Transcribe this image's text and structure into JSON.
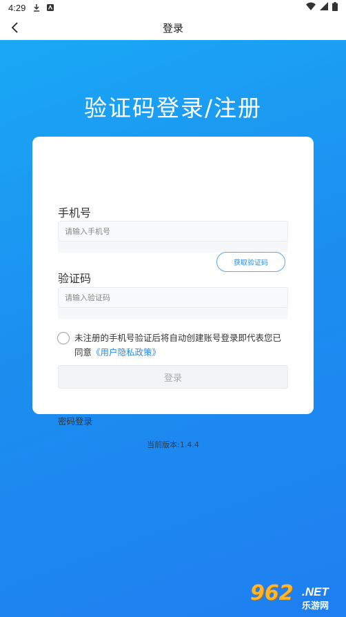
{
  "status_bar": {
    "time": "4:29",
    "icons_left": [
      "download-icon",
      "notification-icon"
    ],
    "icons_right": [
      "wifi-icon",
      "signal-icon",
      "battery-icon"
    ]
  },
  "header": {
    "title": "登录",
    "back_icon": "back-arrow-icon"
  },
  "hero": {
    "title": "验证码登录/注册"
  },
  "form": {
    "phone_label": "手机号",
    "phone_placeholder": "请输入手机号",
    "code_label": "验证码",
    "code_placeholder": "请输入验证码",
    "get_code_label": "获取验证码",
    "agreement_text": "未注册的手机号验证后将自动创建账号登录即代表您已同意",
    "agreement_link": "《用户隐私政策》",
    "login_label": "登录",
    "password_login_label": "密码登录"
  },
  "footer": {
    "version": "当前版本:1.4.4"
  },
  "watermark": {
    "number": "962",
    "domain": ".NET",
    "name": "乐游网"
  },
  "colors": {
    "brand_blue": "#1c8ff0",
    "link_blue": "#2a8ae8",
    "watermark_orange": "#ffb52e"
  }
}
